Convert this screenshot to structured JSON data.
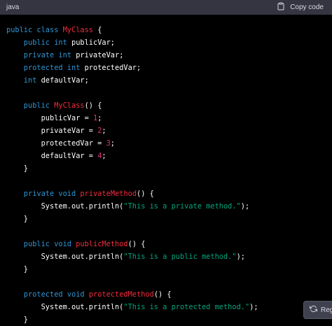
{
  "header": {
    "language": "java",
    "copy_label": "Copy code"
  },
  "regenerate": {
    "label": "Reg"
  },
  "colors": {
    "keyword": "#2e95d3",
    "class_name": "#f22c3d",
    "number": "#df3079",
    "string": "#00a67d",
    "plain": "#ffffff",
    "header_bg": "#343541"
  },
  "code": {
    "lines": [
      [
        {
          "t": "public class ",
          "c": "kw"
        },
        {
          "t": "MyClass",
          "c": "cls"
        },
        {
          "t": " {",
          "c": ""
        }
      ],
      [
        {
          "t": "    public ",
          "c": "kw"
        },
        {
          "t": "int",
          "c": "kw"
        },
        {
          "t": " publicVar;",
          "c": ""
        }
      ],
      [
        {
          "t": "    private ",
          "c": "kw"
        },
        {
          "t": "int",
          "c": "kw"
        },
        {
          "t": " privateVar;",
          "c": ""
        }
      ],
      [
        {
          "t": "    protected ",
          "c": "kw"
        },
        {
          "t": "int",
          "c": "kw"
        },
        {
          "t": " protectedVar;",
          "c": ""
        }
      ],
      [
        {
          "t": "    int",
          "c": "kw"
        },
        {
          "t": " defaultVar;",
          "c": ""
        }
      ],
      [],
      [
        {
          "t": "    public ",
          "c": "kw"
        },
        {
          "t": "MyClass",
          "c": "cls"
        },
        {
          "t": "() {",
          "c": ""
        }
      ],
      [
        {
          "t": "        publicVar = ",
          "c": ""
        },
        {
          "t": "1",
          "c": "num"
        },
        {
          "t": ";",
          "c": ""
        }
      ],
      [
        {
          "t": "        privateVar = ",
          "c": ""
        },
        {
          "t": "2",
          "c": "num"
        },
        {
          "t": ";",
          "c": ""
        }
      ],
      [
        {
          "t": "        protectedVar = ",
          "c": ""
        },
        {
          "t": "3",
          "c": "num"
        },
        {
          "t": ";",
          "c": ""
        }
      ],
      [
        {
          "t": "        defaultVar = ",
          "c": ""
        },
        {
          "t": "4",
          "c": "num"
        },
        {
          "t": ";",
          "c": ""
        }
      ],
      [
        {
          "t": "    }",
          "c": ""
        }
      ],
      [],
      [
        {
          "t": "    private ",
          "c": "kw"
        },
        {
          "t": "void",
          "c": "kw"
        },
        {
          "t": " ",
          "c": ""
        },
        {
          "t": "privateMethod",
          "c": "cls"
        },
        {
          "t": "() {",
          "c": ""
        }
      ],
      [
        {
          "t": "        System.out.println(",
          "c": ""
        },
        {
          "t": "\"This is a private method.\"",
          "c": "str"
        },
        {
          "t": ");",
          "c": ""
        }
      ],
      [
        {
          "t": "    }",
          "c": ""
        }
      ],
      [],
      [
        {
          "t": "    public ",
          "c": "kw"
        },
        {
          "t": "void",
          "c": "kw"
        },
        {
          "t": " ",
          "c": ""
        },
        {
          "t": "publicMethod",
          "c": "cls"
        },
        {
          "t": "() {",
          "c": ""
        }
      ],
      [
        {
          "t": "        System.out.println(",
          "c": ""
        },
        {
          "t": "\"This is a public method.\"",
          "c": "str"
        },
        {
          "t": ");",
          "c": ""
        }
      ],
      [
        {
          "t": "    }",
          "c": ""
        }
      ],
      [],
      [
        {
          "t": "    protected ",
          "c": "kw"
        },
        {
          "t": "void",
          "c": "kw"
        },
        {
          "t": " ",
          "c": ""
        },
        {
          "t": "protectedMethod",
          "c": "cls"
        },
        {
          "t": "() {",
          "c": ""
        }
      ],
      [
        {
          "t": "        System.out.println(",
          "c": ""
        },
        {
          "t": "\"This is a protected method.\"",
          "c": "str"
        },
        {
          "t": ");",
          "c": ""
        }
      ],
      [
        {
          "t": "    }",
          "c": ""
        }
      ]
    ]
  }
}
